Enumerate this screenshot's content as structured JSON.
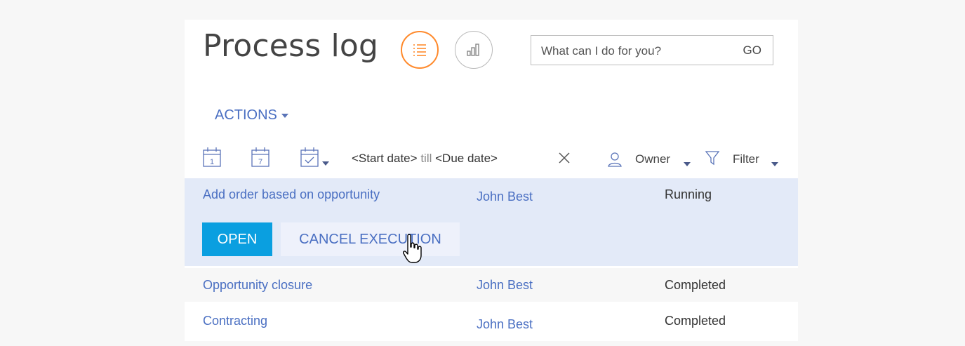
{
  "header": {
    "title": "Process log",
    "views": [
      {
        "name": "list",
        "icon": "list-icon",
        "active": true
      },
      {
        "name": "analytics",
        "icon": "bar-chart-icon",
        "active": false
      }
    ],
    "search": {
      "placeholder": "What can I do for you?",
      "go_label": "GO"
    }
  },
  "toolbar": {
    "actions_label": "ACTIONS"
  },
  "filters": {
    "calendar_day": "1",
    "calendar_week": "7",
    "date_start": "<Start date>",
    "date_till": "till",
    "date_due": "<Due date>",
    "owner_label": "Owner",
    "filter_label": "Filter"
  },
  "rows": [
    {
      "name": "Add order based on opportunity",
      "owner": "John Best",
      "status": "Running",
      "selected": true
    },
    {
      "name": "Opportunity closure",
      "owner": "John Best",
      "status": "Completed",
      "selected": false
    },
    {
      "name": "Contracting",
      "owner": "John Best",
      "status": "Completed",
      "selected": false
    }
  ],
  "row_actions": {
    "open_label": "OPEN",
    "cancel_label": "CANCEL EXECUTION"
  },
  "colors": {
    "accent_orange": "#ff8a2c",
    "link_blue": "#4a6fc2",
    "primary_button": "#0a9fe0",
    "selected_row": "#e3eaf8"
  }
}
